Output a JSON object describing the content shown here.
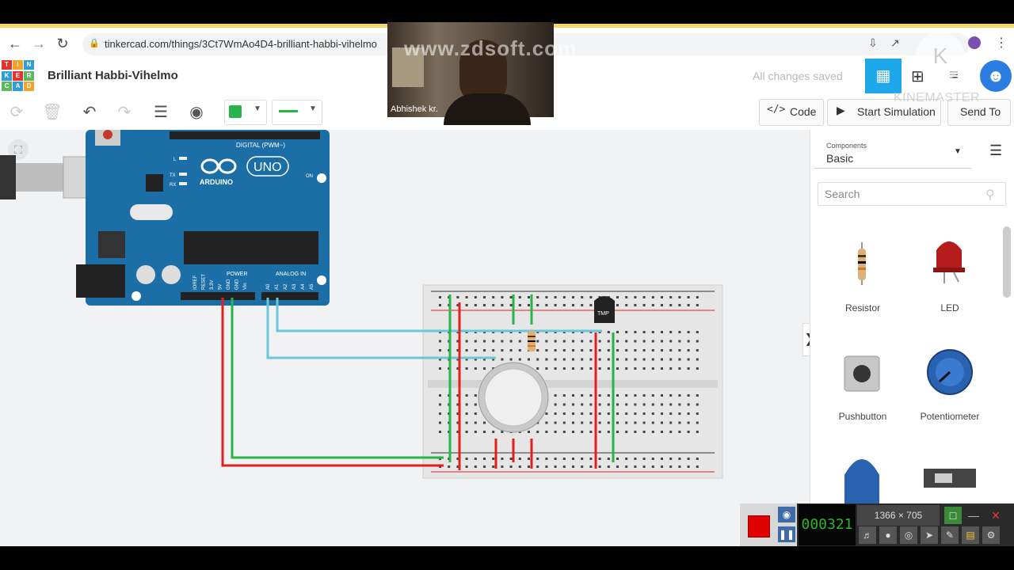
{
  "browser": {
    "url": "tinkercad.com/things/3Ct7WmAo4D4-brilliant-habbi-vihelmo"
  },
  "app": {
    "logo_letters": [
      "T",
      "I",
      "N",
      "K",
      "E",
      "R",
      "C",
      "A",
      "D"
    ],
    "title": "Brilliant Habbi-Vihelmo",
    "save_status": "All changes saved"
  },
  "toolbar": {
    "code_label": "Code",
    "simulate_label": "Start Simulation",
    "send_label": "Send To",
    "wire_color": "#2ab34a"
  },
  "sidebar": {
    "components_caption": "Components",
    "components_value": "Basic",
    "search_placeholder": "Search",
    "parts": [
      "Resistor",
      "LED",
      "Pushbutton",
      "Potentiometer"
    ]
  },
  "arduino": {
    "logo": "ARDUINO",
    "model": "UNO",
    "digital_label": "DIGITAL (PWM~)",
    "power_label": "POWER",
    "analog_label": "ANALOG IN",
    "on_label": "ON",
    "power_pins": [
      "IOREF",
      "RESET",
      "3.3V",
      "5V",
      "GND",
      "GND",
      "Vin"
    ],
    "analog_pins": [
      "A0",
      "A1",
      "A2",
      "A3",
      "A4",
      "A5"
    ],
    "led_labels": [
      "L",
      "TX",
      "RX"
    ]
  },
  "breadboard": {
    "sensor_label": "TMP"
  },
  "webcam": {
    "name": "Abhishek kr.",
    "watermark": "www.zdsoft.com"
  },
  "overlay": {
    "kinemaster": "KINEMASTER"
  },
  "recorder": {
    "timer": "000321",
    "resolution": "1366 × 705"
  },
  "colors": {
    "accent": "#1ea7ea",
    "arduino_blue": "#1b6fa6",
    "wire_red": "#e02020",
    "wire_green": "#2ab34a",
    "wire_cyan": "#6dc5d8"
  }
}
